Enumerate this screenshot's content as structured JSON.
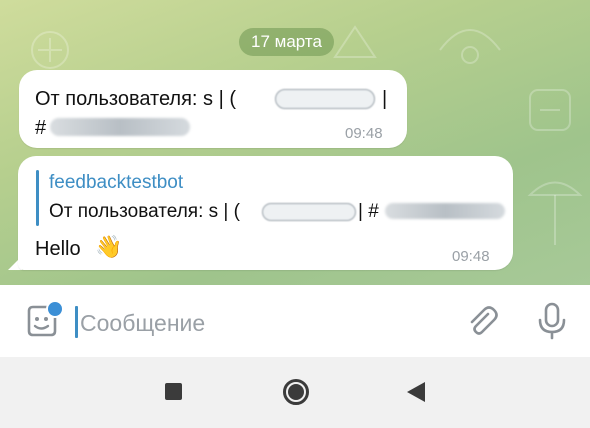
{
  "date_separator": "17 марта",
  "messages": [
    {
      "line1": "От пользователя: s | (",
      "line1_end": "|",
      "line2": "#",
      "time": "09:48"
    },
    {
      "quote_author": "feedbacktestbot",
      "quote_text": "От пользователя: s | (",
      "quote_mid": "| #",
      "text": "Hello",
      "emoji": "👋",
      "time": "09:48"
    }
  ],
  "composer": {
    "placeholder": "Сообщение"
  },
  "icons": {
    "sticker": "sticker-icon",
    "attach": "paperclip-icon",
    "mic": "microphone-icon",
    "nav_recent": "square-icon",
    "nav_home": "circle-icon",
    "nav_back": "triangle-back-icon"
  },
  "colors": {
    "accent": "#3e8ec4",
    "bubble": "#ffffff",
    "time": "#9aa0a6"
  }
}
